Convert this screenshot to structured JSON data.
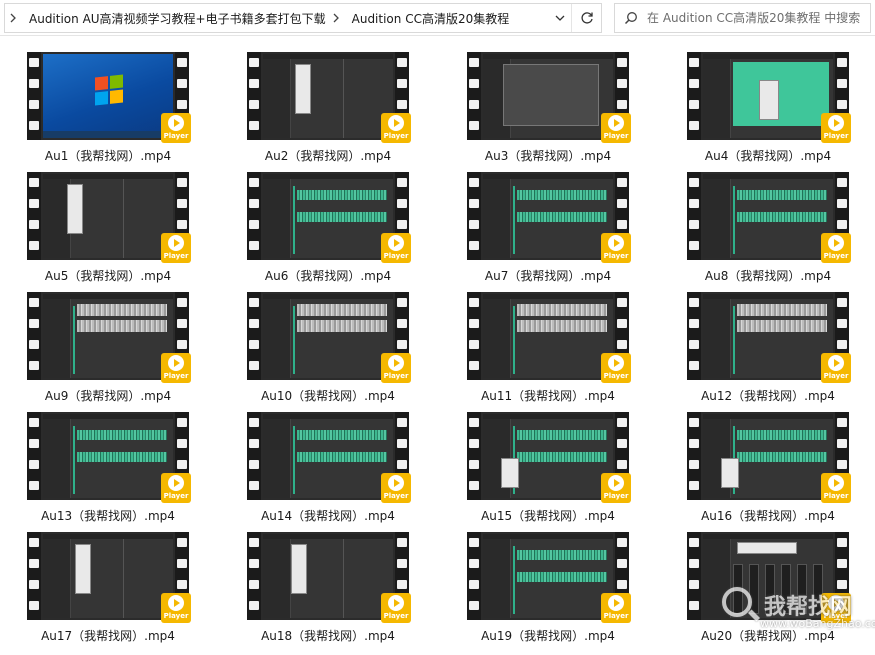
{
  "breadcrumb": {
    "items": [
      "Audition AU高清视频学习教程+电子书籍多套打包下载",
      "Audition CC高清版20集教程"
    ]
  },
  "search": {
    "placeholder": "在 Audition CC高清版20集教程 中搜索"
  },
  "thumbnail_badge": "Player",
  "files": [
    {
      "name": "Au1（我帮找网）.mp4",
      "preview": "desktop"
    },
    {
      "name": "Au2（我帮找网）.mp4",
      "preview": "menu"
    },
    {
      "name": "Au3（我帮找网）.mp4",
      "preview": "dialog"
    },
    {
      "name": "Au4（我帮找网）.mp4",
      "preview": "teal"
    },
    {
      "name": "Au5（我帮找网）.mp4",
      "preview": "menu"
    },
    {
      "name": "Au6（我帮找网）.mp4",
      "preview": "waves"
    },
    {
      "name": "Au7（我帮找网）.mp4",
      "preview": "waves"
    },
    {
      "name": "Au8（我帮找网）.mp4",
      "preview": "waves"
    },
    {
      "name": "Au9（我帮找网）.mp4",
      "preview": "grey"
    },
    {
      "name": "Au10（我帮找网）.mp4",
      "preview": "grey"
    },
    {
      "name": "Au11（我帮找网）.mp4",
      "preview": "grey"
    },
    {
      "name": "Au12（我帮找网）.mp4",
      "preview": "grey"
    },
    {
      "name": "Au13（我帮找网）.mp4",
      "preview": "waves"
    },
    {
      "name": "Au14（我帮找网）.mp4",
      "preview": "waves"
    },
    {
      "name": "Au15（我帮找网）.mp4",
      "preview": "waves"
    },
    {
      "name": "Au16（我帮找网）.mp4",
      "preview": "waves"
    },
    {
      "name": "Au17（我帮找网）.mp4",
      "preview": "menu"
    },
    {
      "name": "Au18（我帮找网）.mp4",
      "preview": "menu"
    },
    {
      "name": "Au19（我帮找网）.mp4",
      "preview": "waves"
    },
    {
      "name": "Au20（我帮找网）.mp4",
      "preview": "mixer"
    }
  ],
  "watermark": {
    "text": "我帮找网",
    "url": "www.woBangZhao.com"
  }
}
